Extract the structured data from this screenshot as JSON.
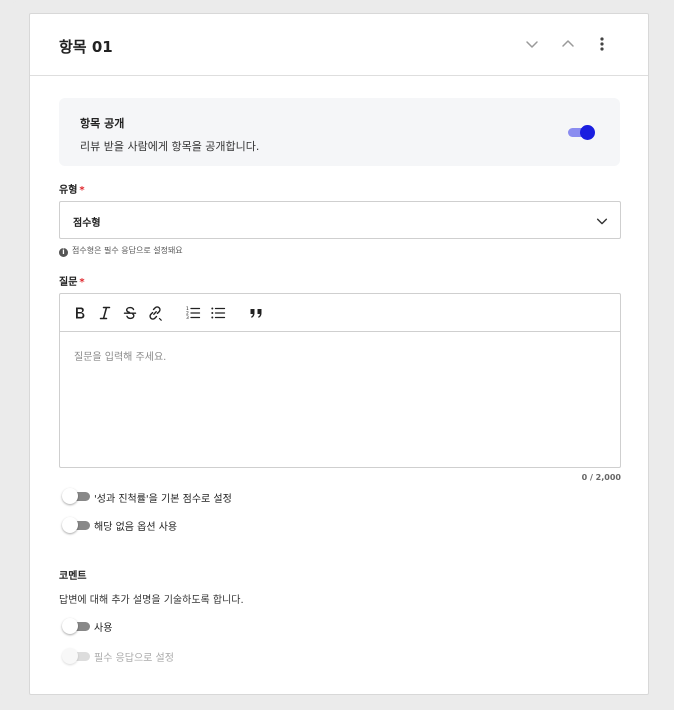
{
  "item": {
    "title": "항목 01"
  },
  "public_section": {
    "title": "항목 공개",
    "description": "리뷰 받을 사람에게 항목을 공개합니다.",
    "enabled": true
  },
  "type_field": {
    "label": "유형",
    "required_mark": "*",
    "value": "점수형",
    "hint": "점수형은 필수 응답으로 설정돼요"
  },
  "question_field": {
    "label": "질문",
    "required_mark": "*",
    "placeholder": "질문을 입력해 주세요.",
    "counter": "0 / 2,000",
    "toolbar": [
      "bold-icon",
      "italic-icon",
      "strikethrough-icon",
      "link-icon",
      "ordered-list-icon",
      "bullet-list-icon",
      "quote-icon"
    ]
  },
  "options": [
    {
      "label": "'성과 진척률'을 기본 점수로 설정",
      "enabled": false
    },
    {
      "label": "해당 없음 옵션 사용",
      "enabled": false
    }
  ],
  "comment_section": {
    "title": "코멘트",
    "description": "답변에 대해 추가 설명을 기술하도록 합니다.",
    "use_label": "사용",
    "required_label": "필수 응답으로 설정"
  },
  "colors": {
    "accent": "#1a1ee0",
    "required": "#e0282e"
  }
}
